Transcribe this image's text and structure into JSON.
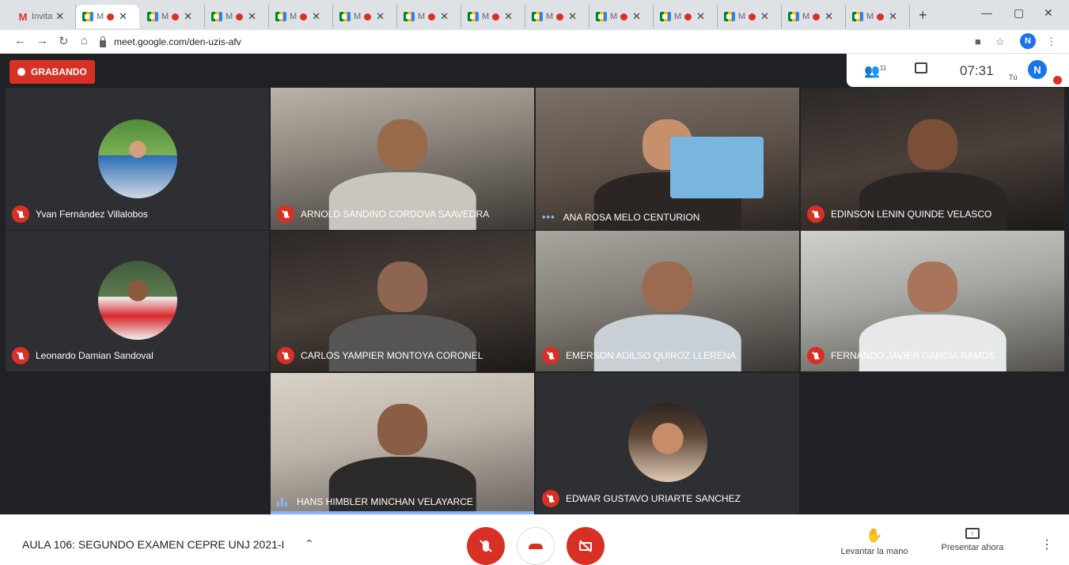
{
  "browser": {
    "tabs": [
      {
        "title": "Invita",
        "favicon": "gmail-icon",
        "active": false
      },
      {
        "title": "M",
        "favicon": "meet-icon",
        "active": true,
        "recording": true
      },
      {
        "title": "M",
        "favicon": "meet-icon",
        "active": false,
        "recording": true
      },
      {
        "title": "M",
        "favicon": "meet-icon",
        "active": false,
        "recording": true
      },
      {
        "title": "M",
        "favicon": "meet-icon",
        "active": false,
        "recording": true
      },
      {
        "title": "M",
        "favicon": "meet-icon",
        "active": false,
        "recording": true
      },
      {
        "title": "M",
        "favicon": "meet-icon",
        "active": false,
        "recording": true
      },
      {
        "title": "M",
        "favicon": "meet-icon",
        "active": false,
        "recording": true
      },
      {
        "title": "M",
        "favicon": "meet-icon",
        "active": false,
        "recording": true
      },
      {
        "title": "M",
        "favicon": "meet-icon",
        "active": false,
        "recording": true
      },
      {
        "title": "M",
        "favicon": "meet-icon",
        "active": false,
        "recording": true
      },
      {
        "title": "M",
        "favicon": "meet-icon",
        "active": false,
        "recording": true
      },
      {
        "title": "M",
        "favicon": "meet-icon",
        "active": false,
        "recording": true
      },
      {
        "title": "M",
        "favicon": "meet-icon",
        "active": false,
        "recording": true
      }
    ],
    "url": "meet.google.com/den-uzis-afv"
  },
  "meet": {
    "recording_label": "GRABANDO",
    "participant_count": "11",
    "clock": "07:31",
    "self_label": "Tú",
    "self_initial": "N",
    "participants": [
      {
        "name": "Yvan Fernández Villalobos",
        "status": "muted",
        "view": "avatar"
      },
      {
        "name": "ARNOLD SANDINO CORDOVA SAAVEDRA",
        "status": "muted",
        "view": "video"
      },
      {
        "name": "ANA ROSA MELO CENTURION",
        "status": "connecting",
        "view": "video"
      },
      {
        "name": "EDINSON LENIN QUINDE VELASCO",
        "status": "muted",
        "view": "video"
      },
      {
        "name": "Leonardo Damian Sandoval",
        "status": "muted",
        "view": "avatar"
      },
      {
        "name": "CARLOS YAMPIER MONTOYA CORONEL",
        "status": "muted",
        "view": "video"
      },
      {
        "name": "EMERSON ADILSO QUIROZ LLERENA",
        "status": "muted",
        "view": "video"
      },
      {
        "name": "FERNANDO JAVIER GARCIA RAMOS",
        "status": "muted",
        "view": "video"
      },
      {
        "name": "HANS HIMBLER MINCHAN VELAYARCE",
        "status": "speaking",
        "view": "video"
      },
      {
        "name": "EDWAR GUSTAVO URIARTE SANCHEZ",
        "status": "muted",
        "view": "avatar"
      }
    ],
    "meeting_title": "AULA 106: SEGUNDO EXAMEN CEPRE UNJ 2021-I",
    "raise_hand_label": "Levantar la mano",
    "present_label": "Presentar ahora"
  },
  "colors": {
    "accent_red": "#d93025",
    "speaking_blue": "#8ab4f8",
    "meet_background": "#202124"
  }
}
